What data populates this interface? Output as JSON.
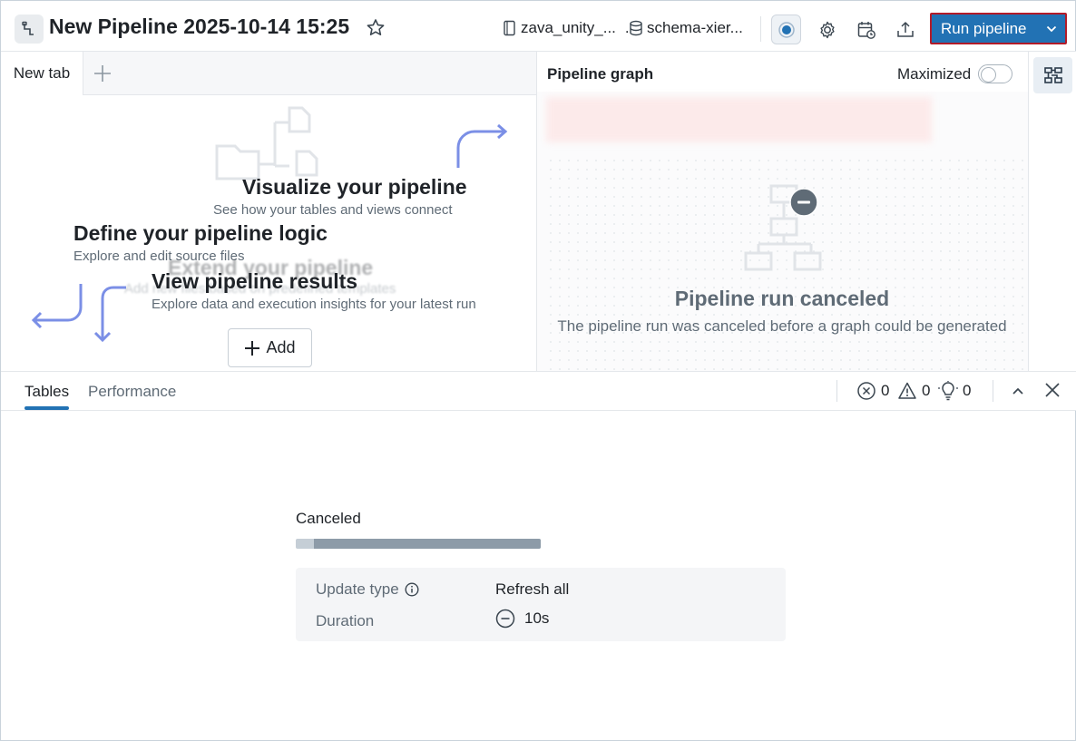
{
  "header": {
    "title": "New Pipeline 2025-10-14 15:25",
    "catalog": "zava_unity_...",
    "schema": "schema-xier...",
    "run_label": "Run pipeline",
    "accent": "#2272b4"
  },
  "editor": {
    "tab_label": "New tab"
  },
  "onboarding": {
    "visualize_title": "Visualize your pipeline",
    "visualize_sub": "See how your tables and views connect",
    "define_title": "Define your pipeline logic",
    "define_sub": "Explore and edit source files",
    "extend_title": "Extend your pipeline",
    "extend_sub": "Add new files based on predefined templates",
    "results_title": "View pipeline results",
    "results_sub": "Explore data and execution insights for your latest run",
    "add_label": "Add"
  },
  "graph": {
    "title": "Pipeline graph",
    "maximized_label": "Maximized",
    "canceled_title": "Pipeline run canceled",
    "canceled_sub": "The pipeline run was canceled before a graph could be generated"
  },
  "bottom": {
    "tabs": [
      "Tables",
      "Performance"
    ],
    "errors": "0",
    "warnings": "0",
    "insights": "0"
  },
  "run": {
    "status": "Canceled",
    "progress": 0.926,
    "update_type_label": "Update type",
    "update_type_value": "Refresh all",
    "duration_label": "Duration",
    "duration_value": "10s"
  }
}
